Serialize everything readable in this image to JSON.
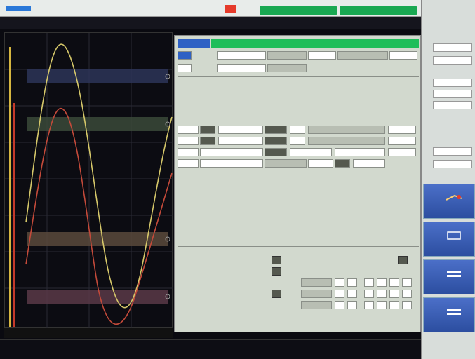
{
  "topbar": {
    "btn1": "",
    "btn2": ""
  },
  "dialog": {
    "tab_label": "",
    "title": "",
    "bottom": {
      "row1_label": "",
      "row2_label": "",
      "row3_label": "",
      "right_label": ""
    }
  },
  "right_panel": {
    "hdr1": "",
    "hdr2": ""
  },
  "colors": {
    "accent_blue": "#2f61c4",
    "accent_green": "#1fbe5a",
    "trace_yellow": "#d6c86a",
    "trace_red": "#c44a3a",
    "panel_bg": "#d2d9ce"
  }
}
